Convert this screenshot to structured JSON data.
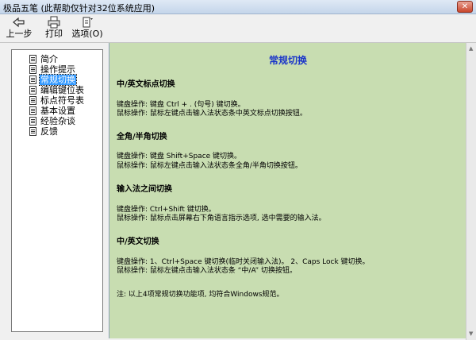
{
  "window": {
    "title": "极品五笔 (此帮助仅针对32位系统应用)",
    "close_glyph": "✕"
  },
  "toolbar": {
    "back_label": "上一步",
    "print_label": "打印",
    "options_label": "选项(O)"
  },
  "sidebar": {
    "items": [
      {
        "label": "简介"
      },
      {
        "label": "操作提示"
      },
      {
        "label": "常规切换"
      },
      {
        "label": "编辑键位表"
      },
      {
        "label": "标点符号表"
      },
      {
        "label": "基本设置"
      },
      {
        "label": "经验杂谈"
      },
      {
        "label": "反馈"
      }
    ],
    "selected": "常规切换"
  },
  "content": {
    "heading": "常规切换",
    "sections": [
      {
        "title": "中/英文标点切换",
        "lines": [
          "键盘操作: 键盘 Ctrl + . (句号) 键切换。",
          "鼠标操作: 鼠标左键点击输入法状态条中英文标点切换按钮。"
        ]
      },
      {
        "title": "全角/半角切换",
        "lines": [
          "键盘操作: 键盘 Shift+Space 键切换。",
          "鼠标操作: 鼠标左键点击输入法状态条全角/半角切换按钮。"
        ]
      },
      {
        "title": "输入法之间切换",
        "lines": [
          "键盘操作: Ctrl+Shift 键切换。",
          "鼠标操作: 鼠标点击屏幕右下角语言指示选项, 选中需要的输入法。"
        ]
      },
      {
        "title": "中/英文切换",
        "lines": [
          "键盘操作: 1、Ctrl+Space 键切换(临时关闭输入法)。 2、Caps Lock 键切换。",
          "鼠标操作: 鼠标左键点击输入法状态条 “中/A” 切换按钮。"
        ]
      }
    ],
    "note": "注: 以上4项常规切换功能项, 均符合Windows规范。"
  },
  "scrollbar": {
    "up_glyph": "▲",
    "down_glyph": "▼"
  },
  "colors": {
    "content_bg": "#c8ddb1",
    "heading": "#1a35c9",
    "selection": "#3399ff"
  }
}
